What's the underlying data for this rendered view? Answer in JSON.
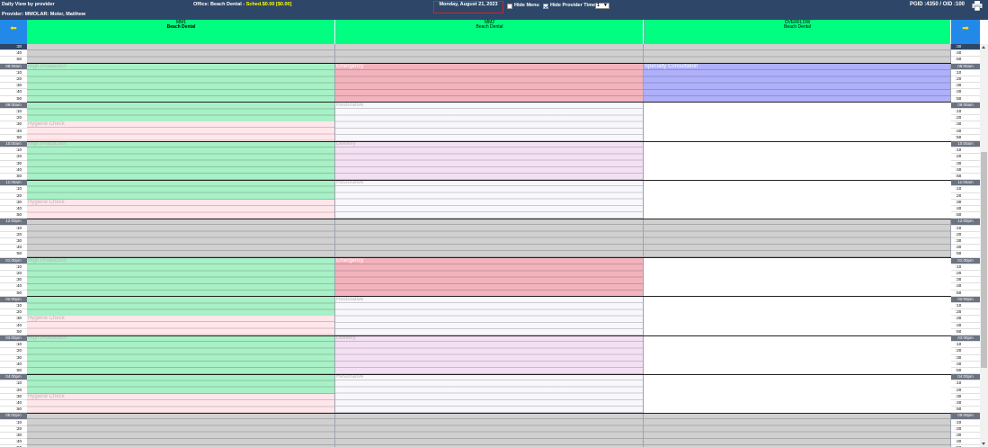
{
  "header": {
    "app_title": "Daily View by provider",
    "provider": "Provider: MMOLAR: Moler, Matthew",
    "office_label": "Office: Beach Dental - ",
    "sched": "Sched.$0.00 [$0.00]",
    "date": "Monday, August 21, 2023",
    "hide_menu_label": "Hide Menu",
    "hide_menu_checked": false,
    "hide_provider_time_label": "Hide Provider Time",
    "hide_provider_time_checked": true,
    "interval_value": "1",
    "pgid": "PGID :4350  /  OID :100",
    "printer_icon": "printer-icon"
  },
  "nav": {
    "prev_icon": "⬅",
    "next_icon": "➡"
  },
  "columns": [
    {
      "id": "MM1",
      "office": "Beach Dental"
    },
    {
      "id": "MM2",
      "office": "Beach Dental"
    },
    {
      "id": "OVERFLOW",
      "office": "Beach Dental"
    }
  ],
  "time_slots": [
    ":30",
    ":40",
    ":50",
    "08:00am",
    ":10",
    ":20",
    ":30",
    ":40",
    ":50",
    "09:00am",
    ":10",
    ":20",
    ":30",
    ":40",
    ":50",
    "10:00am",
    ":10",
    ":20",
    ":30",
    ":40",
    ":50",
    "11:00am",
    ":10",
    ":20",
    ":30",
    ":40",
    ":50",
    "12:00pm",
    ":10",
    ":20",
    ":30",
    ":40",
    ":50",
    "01:00pm",
    ":10",
    ":20",
    ":30",
    ":40",
    ":50",
    "02:00pm",
    ":10",
    ":20",
    ":30",
    ":40",
    ":50",
    "03:00pm",
    ":10",
    ":20",
    ":30",
    ":40",
    ":50",
    "04:00pm",
    ":10",
    ":20",
    ":30",
    ":40",
    ":50",
    "05:00pm",
    ":10",
    ":20",
    ":30",
    ":40",
    ":50"
  ],
  "colors": {
    "hygiene_production": "#a8f0c6",
    "hygiene_check": "#ffe6ea",
    "emergency": "#f2b3bd",
    "restorative": "#f7f7fc",
    "delivery": "#f4e0f3",
    "specialty": "#aeb0fa",
    "blocked": "#d0d0d0"
  },
  "blocks": [
    {
      "col": 0,
      "start": 0,
      "end": 3,
      "type": "blocked",
      "label": ""
    },
    {
      "col": 1,
      "start": 0,
      "end": 3,
      "type": "blocked",
      "label": ""
    },
    {
      "col": 2,
      "start": 0,
      "end": 3,
      "type": "blocked",
      "label": ""
    },
    {
      "col": 0,
      "start": 3,
      "end": 12,
      "type": "hygiene_production",
      "label": "High Production"
    },
    {
      "col": 0,
      "start": 12,
      "end": 15,
      "type": "hygiene_check",
      "label": "Hygiene Check"
    },
    {
      "col": 0,
      "start": 15,
      "end": 24,
      "type": "hygiene_production",
      "label": "High Production"
    },
    {
      "col": 0,
      "start": 24,
      "end": 27,
      "type": "hygiene_check",
      "label": "Hygiene Check"
    },
    {
      "col": 0,
      "start": 27,
      "end": 33,
      "type": "blocked",
      "label": ""
    },
    {
      "col": 0,
      "start": 33,
      "end": 42,
      "type": "hygiene_production",
      "label": "High Production"
    },
    {
      "col": 0,
      "start": 42,
      "end": 45,
      "type": "hygiene_check",
      "label": "Hygiene Check"
    },
    {
      "col": 0,
      "start": 45,
      "end": 54,
      "type": "hygiene_production",
      "label": "High Production"
    },
    {
      "col": 0,
      "start": 54,
      "end": 57,
      "type": "hygiene_check",
      "label": "Hygiene Check"
    },
    {
      "col": 0,
      "start": 57,
      "end": 63,
      "type": "blocked",
      "label": ""
    },
    {
      "col": 1,
      "start": 3,
      "end": 9,
      "type": "emergency",
      "label": "Emergency"
    },
    {
      "col": 1,
      "start": 9,
      "end": 15,
      "type": "restorative",
      "label": "Restorative"
    },
    {
      "col": 1,
      "start": 15,
      "end": 21,
      "type": "delivery",
      "label": "Delivery"
    },
    {
      "col": 1,
      "start": 21,
      "end": 27,
      "type": "restorative",
      "label": "Restorative"
    },
    {
      "col": 1,
      "start": 27,
      "end": 33,
      "type": "blocked",
      "label": ""
    },
    {
      "col": 1,
      "start": 33,
      "end": 39,
      "type": "emergency",
      "label": "Emergency"
    },
    {
      "col": 1,
      "start": 39,
      "end": 45,
      "type": "restorative",
      "label": "Restorative"
    },
    {
      "col": 1,
      "start": 45,
      "end": 51,
      "type": "delivery",
      "label": "Delivery"
    },
    {
      "col": 1,
      "start": 51,
      "end": 57,
      "type": "restorative",
      "label": "Restorative"
    },
    {
      "col": 1,
      "start": 57,
      "end": 63,
      "type": "blocked",
      "label": ""
    },
    {
      "col": 2,
      "start": 3,
      "end": 9,
      "type": "specialty",
      "label": "Specialty Consultation"
    },
    {
      "col": 2,
      "start": 27,
      "end": 33,
      "type": "blocked",
      "label": ""
    },
    {
      "col": 2,
      "start": 57,
      "end": 63,
      "type": "blocked",
      "label": ""
    }
  ]
}
